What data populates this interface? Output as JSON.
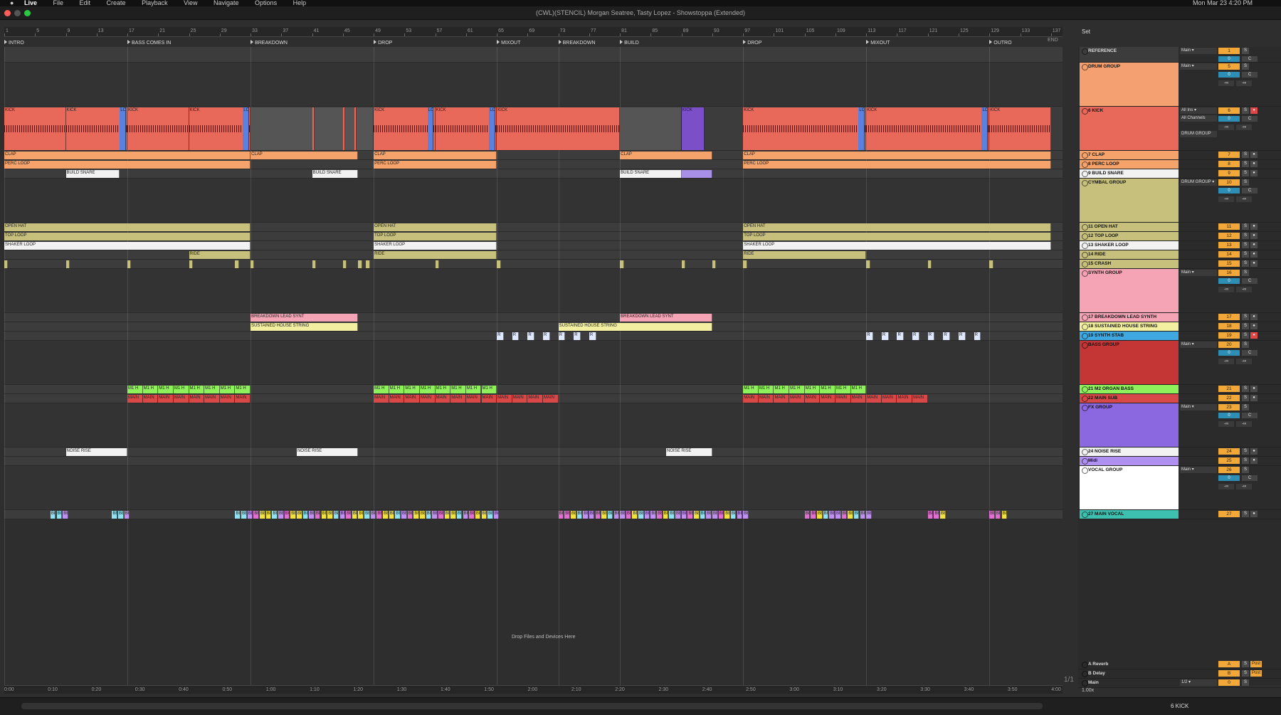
{
  "menubar": {
    "items": [
      "Live",
      "File",
      "Edit",
      "Create",
      "Playback",
      "View",
      "Navigate",
      "Options",
      "Help"
    ],
    "clock": "Mon Mar 23  4:20 PM"
  },
  "window": {
    "title": "(CWL)(STENCIL) Morgan Seatree, Tasty Lopez - Showstoppa (Extended)"
  },
  "ruler": {
    "bars": [
      "1",
      "5",
      "9",
      "13",
      "17",
      "21",
      "25",
      "29",
      "33",
      "37",
      "41",
      "45",
      "49",
      "53",
      "57",
      "61",
      "65",
      "69",
      "73",
      "77",
      "81",
      "85",
      "89",
      "93",
      "97",
      "101",
      "105",
      "109",
      "113",
      "117",
      "121",
      "125",
      "129",
      "133",
      "137"
    ],
    "end_label": "END"
  },
  "locators": [
    {
      "name": "INTRO",
      "bar": 1
    },
    {
      "name": "BASS COMES IN",
      "bar": 17
    },
    {
      "name": "BREAKDOWN",
      "bar": 33
    },
    {
      "name": "DROP",
      "bar": 49
    },
    {
      "name": "MIXOUT",
      "bar": 65
    },
    {
      "name": "BREAKDOWN",
      "bar": 73
    },
    {
      "name": "BUILD",
      "bar": 81
    },
    {
      "name": "DROP",
      "bar": 97
    },
    {
      "name": "MIXOUT",
      "bar": 113
    },
    {
      "name": "OUTRO",
      "bar": 129
    }
  ],
  "timeline": [
    "0:00",
    "0:10",
    "0:20",
    "0:30",
    "0:40",
    "0:50",
    "1:00",
    "1:10",
    "1:20",
    "1:30",
    "1:40",
    "1:50",
    "2:00",
    "2:10",
    "2:20",
    "2:30",
    "2:40",
    "2:50",
    "3:00",
    "3:10",
    "3:20",
    "3:30",
    "3:40",
    "3:50",
    "4:00"
  ],
  "drop_hint": "Drop Files and Devices Here",
  "pager": "1/1",
  "zoom": "1.00x",
  "selected_track": "6 KICK",
  "set_label": "Set",
  "colors": {
    "kick": "#e8685a",
    "drum_group": "#f5a070",
    "clap": "#f5a36a",
    "build_snare": "#f2f2f2",
    "cymbal": "#c6c07c",
    "synth_group": "#f4a4b4",
    "synth_stab": "#3fa8e0",
    "bass_group": "#c43636",
    "organ_bass": "#8ef05a",
    "main_sub": "#d94848",
    "fx_group": "#8c68e0",
    "midi": "#b090f0",
    "vocal_group": "#ffffff",
    "main_vocal": "#3ec0b0",
    "return": "#3c3c3c"
  },
  "tracks": [
    {
      "name": "REFERENCE",
      "num": "1",
      "routing": "Main",
      "color": "#3c3c3c",
      "light": true,
      "type": "ref"
    },
    {
      "name": "DRUM GROUP",
      "num": "5",
      "routing": "Main",
      "color": "#f5a070",
      "type": "group"
    },
    {
      "name": "6 KICK",
      "num": "6",
      "routing": "All Ins",
      "routing2": "All Channels",
      "routing3": "DRUM GROUP",
      "color": "#e8685a",
      "type": "audio",
      "armed": true
    },
    {
      "name": "7 CLAP",
      "num": "7",
      "color": "#f5a36a",
      "type": "audio"
    },
    {
      "name": "8 PERC LOOP",
      "num": "8",
      "color": "#f5a36a",
      "type": "audio"
    },
    {
      "name": "9 BUILD SNARE",
      "num": "9",
      "color": "#f2f2f2",
      "type": "audio"
    },
    {
      "name": "CYMBAL GROUP",
      "num": "10",
      "routing": "DRUM GROUP",
      "color": "#c6c07c",
      "type": "group"
    },
    {
      "name": "11 OPEN HAT",
      "num": "11",
      "color": "#c6c07c",
      "type": "audio"
    },
    {
      "name": "12 TOP LOOP",
      "num": "12",
      "color": "#c6c07c",
      "type": "audio"
    },
    {
      "name": "13 SHAKER LOOP",
      "num": "13",
      "color": "#f2f2f2",
      "type": "audio"
    },
    {
      "name": "14 RIDE",
      "num": "14",
      "color": "#c6c07c",
      "type": "audio"
    },
    {
      "name": "15 CRASH",
      "num": "15",
      "color": "#c6c07c",
      "type": "audio"
    },
    {
      "name": "SYNTH GROUP",
      "num": "16",
      "routing": "Main",
      "color": "#f4a4b4",
      "type": "group"
    },
    {
      "name": "17 BREAKDOWN LEAD SYNTH",
      "num": "17",
      "color": "#f4a4b4",
      "type": "audio"
    },
    {
      "name": "18 SUSTAINED HOUSE STRING",
      "num": "18",
      "color": "#f2f0a0",
      "type": "audio"
    },
    {
      "name": "19 SYNTH STAB",
      "num": "19",
      "color": "#3fa8e0",
      "type": "audio",
      "armed": true
    },
    {
      "name": "BASS GROUP",
      "num": "20",
      "routing": "Main",
      "color": "#c43636",
      "type": "group"
    },
    {
      "name": "21 M2 ORGAN BASS",
      "num": "21",
      "color": "#8ef05a",
      "type": "audio"
    },
    {
      "name": "22 MAIN SUB",
      "num": "22",
      "color": "#d94848",
      "type": "audio"
    },
    {
      "name": "FX GROUP",
      "num": "23",
      "routing": "Main",
      "color": "#8c68e0",
      "type": "group"
    },
    {
      "name": "24 NOISE RISE",
      "num": "24",
      "color": "#f2f2f2",
      "type": "audio"
    },
    {
      "name": "Midi",
      "num": "25",
      "color": "#b090f0",
      "type": "audio"
    },
    {
      "name": "VOCAL GROUP",
      "num": "26",
      "routing": "Main",
      "color": "#ffffff",
      "type": "group"
    },
    {
      "name": "27 MAIN VOCAL",
      "num": "27",
      "color": "#3ec0b0",
      "type": "audio"
    },
    {
      "name": "A Reverb",
      "num": "A",
      "color": "#2b2b2b",
      "light": true,
      "type": "return",
      "post": "Post"
    },
    {
      "name": "B Delay",
      "num": "B",
      "color": "#2b2b2b",
      "light": true,
      "type": "return",
      "post": "Post"
    },
    {
      "name": "Main",
      "num": "0",
      "routing": "1/2",
      "color": "#2b2b2b",
      "light": true,
      "type": "main"
    }
  ],
  "clips": {
    "kick": "KICK",
    "lo": "LO",
    "clap": "CLAP",
    "perc": "PERC LOOP",
    "build_snare": "BUILD SNARE",
    "open_hat": "OPEN HAT",
    "top_loop": "TOP LOOP",
    "shaker": "SHAKER LOOP",
    "ride": "RIDE",
    "lead": "BREAKDOWN LEAD SYNT",
    "string": "SUSTAINED HOUSE STRING",
    "stab": "R",
    "organ": "M1 H",
    "sub": "MAIN",
    "noise": "NOISE RISE",
    "vocal": "BE"
  }
}
